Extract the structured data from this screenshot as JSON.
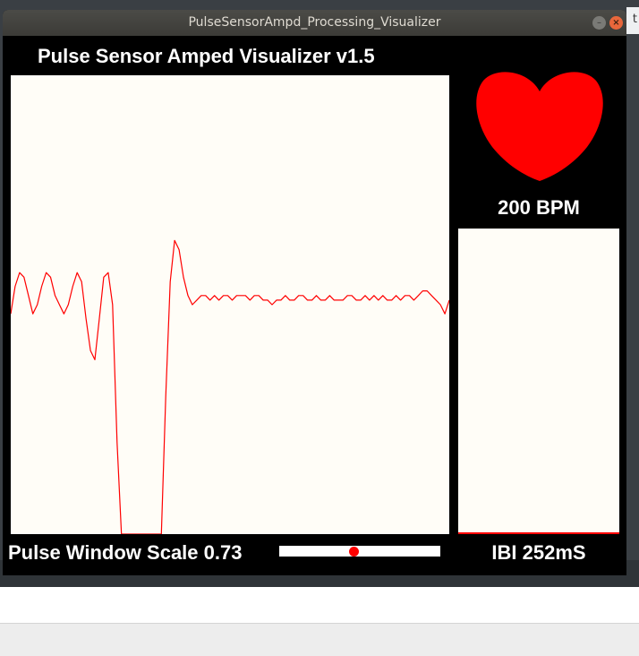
{
  "window": {
    "title": "PulseSensorAmpd_Processing_Visualizer",
    "minimize_glyph": "–",
    "close_glyph": "×"
  },
  "desktop": {
    "edge_glyph": "t"
  },
  "app": {
    "heading": "Pulse Sensor Amped Visualizer v1.5",
    "bpm_label": "200 BPM",
    "ibi_label": "IBI 252mS",
    "scale_label": "Pulse Window Scale 0.73",
    "scale_fraction": 0.46,
    "bpm_history_fraction": 0.0
  },
  "colors": {
    "heart": "#ff0000",
    "trace": "#ff0000",
    "panel": "#fffdf7",
    "background": "#000000"
  },
  "chart_data": {
    "type": "line",
    "series": [
      {
        "values": [
          0.48,
          0.54,
          0.57,
          0.56,
          0.52,
          0.48,
          0.5,
          0.54,
          0.57,
          0.56,
          0.52,
          0.5,
          0.48,
          0.5,
          0.54,
          0.57,
          0.55,
          0.47,
          0.4,
          0.38,
          0.47,
          0.56,
          0.57,
          0.5,
          0.2,
          -0.1,
          -0.42,
          -0.42,
          -0.42,
          -0.42,
          -0.42,
          -0.42,
          -0.42,
          -0.42,
          -0.2,
          0.3,
          0.55,
          0.64,
          0.62,
          0.56,
          0.52,
          0.5,
          0.51,
          0.52,
          0.52,
          0.51,
          0.52,
          0.51,
          0.52,
          0.52,
          0.51,
          0.52,
          0.52,
          0.52,
          0.51,
          0.52,
          0.52,
          0.51,
          0.51,
          0.5,
          0.51,
          0.51,
          0.52,
          0.51,
          0.51,
          0.52,
          0.52,
          0.51,
          0.51,
          0.52,
          0.51,
          0.51,
          0.52,
          0.51,
          0.51,
          0.51,
          0.52,
          0.52,
          0.51,
          0.51,
          0.52,
          0.51,
          0.52,
          0.51,
          0.52,
          0.51,
          0.51,
          0.52,
          0.51,
          0.52,
          0.52,
          0.51,
          0.52,
          0.53,
          0.53,
          0.52,
          0.51,
          0.5,
          0.48,
          0.51
        ]
      }
    ]
  }
}
